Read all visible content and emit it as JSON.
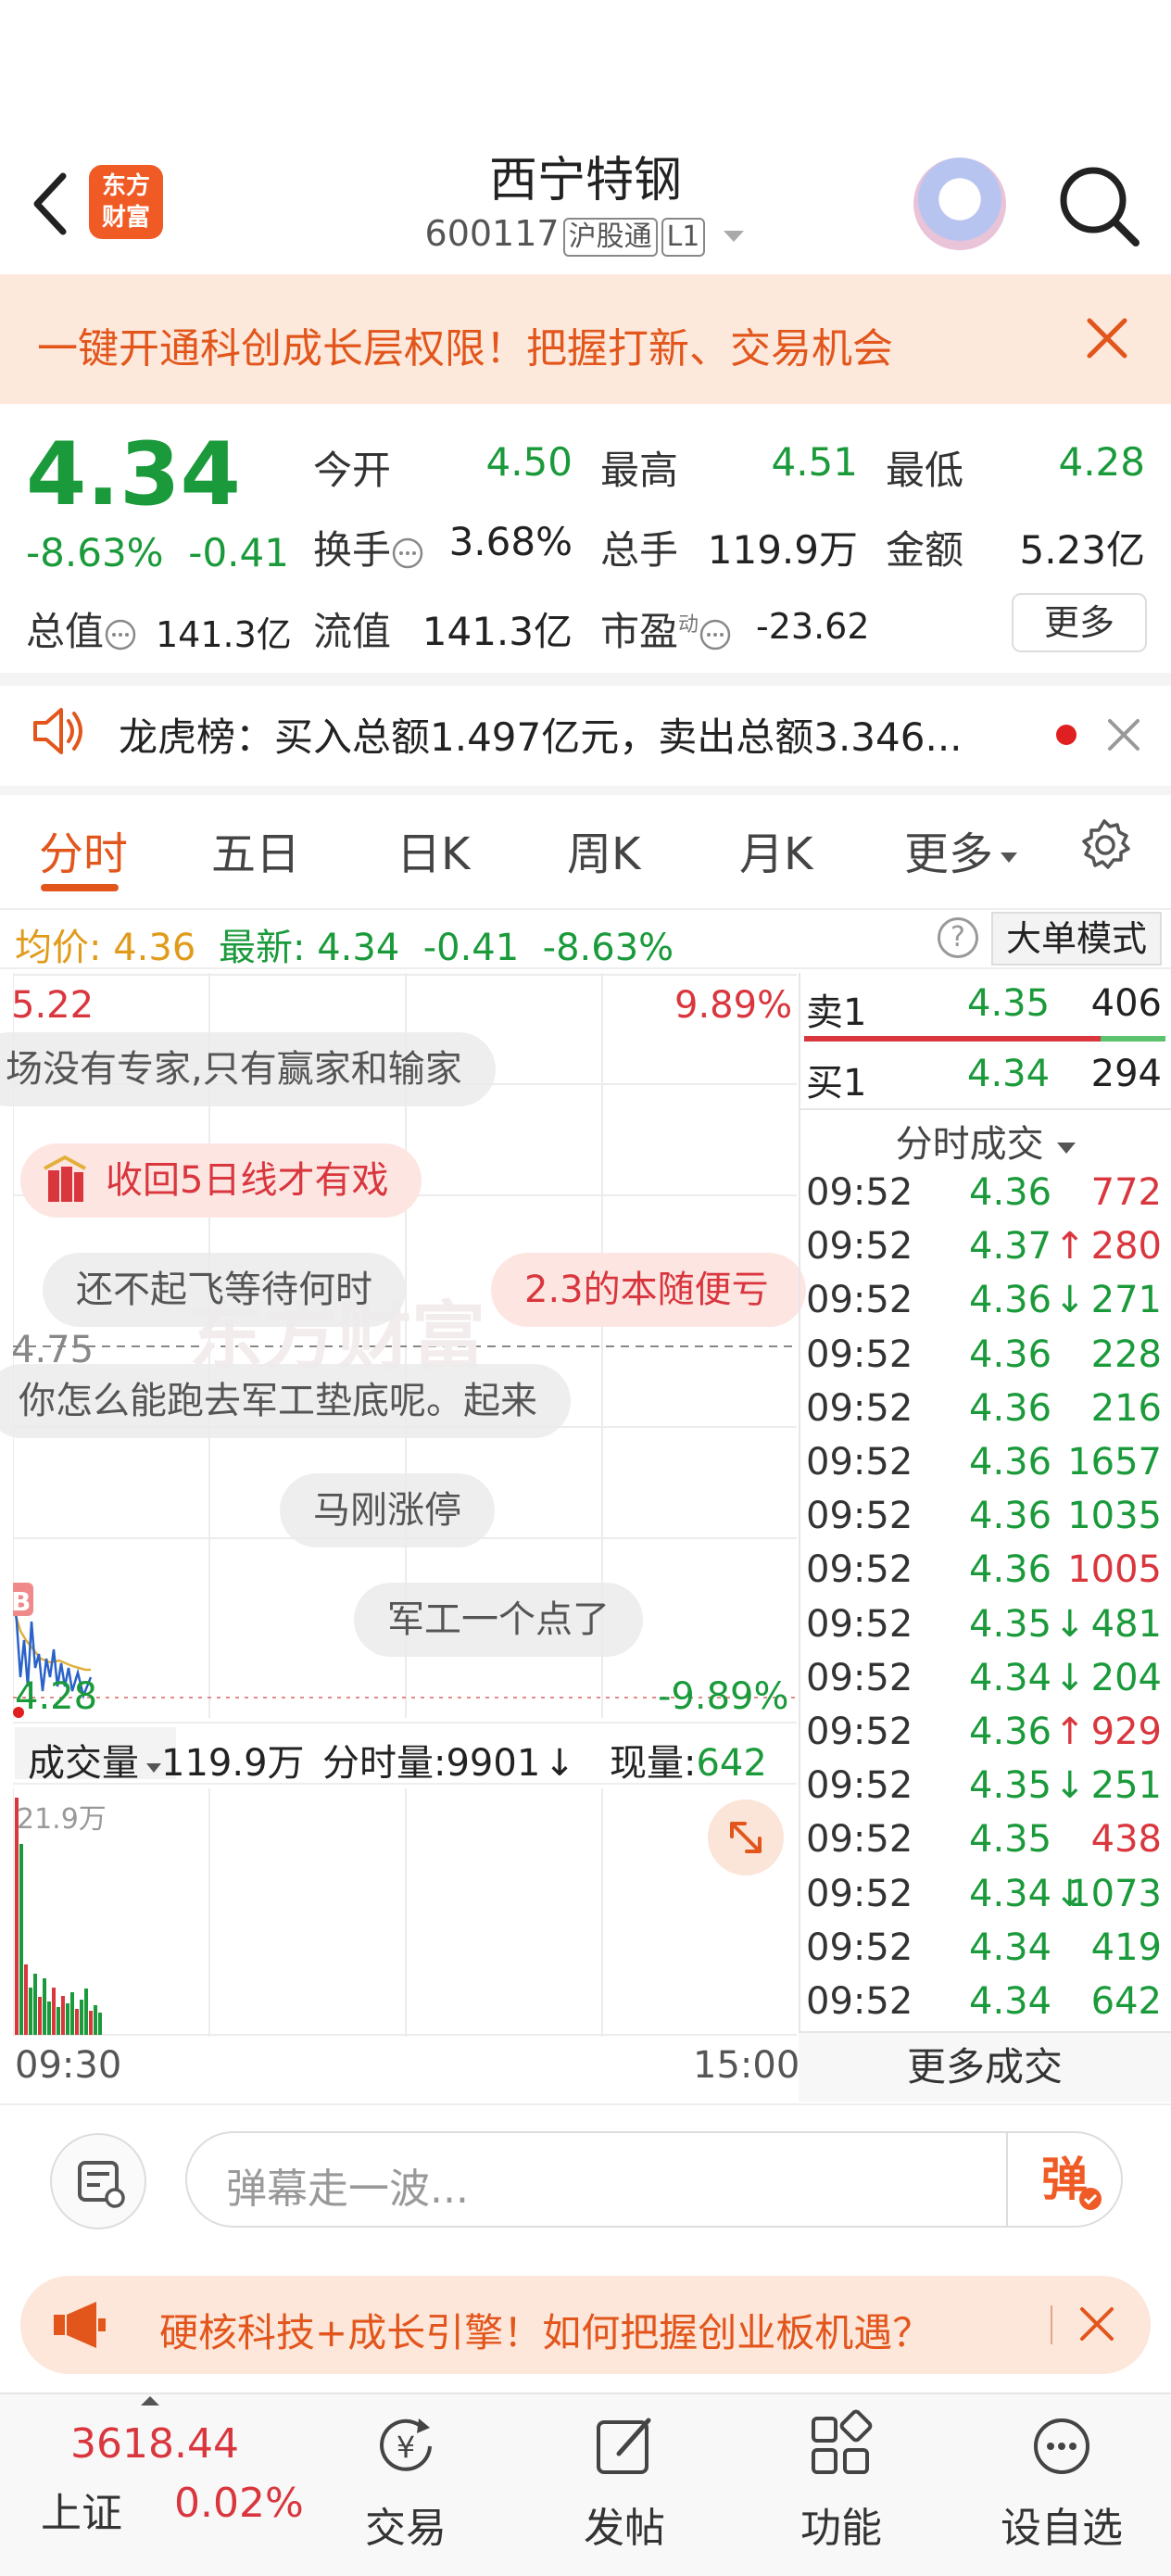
{
  "header": {
    "logo_line1": "东方",
    "logo_line2": "财富",
    "title": "西宁特钢",
    "code": "600117",
    "market_badge": "沪股通",
    "level_badge": "L1"
  },
  "banner": {
    "text": "一键开通科创成长层权限！把握打新、交易机会"
  },
  "quote": {
    "price": "4.34",
    "change_pct": "-8.63%",
    "change_abs": "-0.41",
    "open_label": "今开",
    "open": "4.50",
    "high_label": "最高",
    "high": "4.51",
    "low_label": "最低",
    "low": "4.28",
    "turnover_label": "换手",
    "turnover": "3.68%",
    "volume_label": "总手",
    "volume": "119.9万",
    "amount_label": "金额",
    "amount": "5.23亿",
    "mktcap_label": "总值",
    "mktcap": "141.3亿",
    "float_label": "流值",
    "float_cap": "141.3亿",
    "pe_label": "市盈",
    "pe_sup": "动",
    "pe": "-23.62",
    "more": "更多"
  },
  "notice": {
    "text": "龙虎榜：买入总额1.497亿元，卖出总额3.346..."
  },
  "tabs": [
    "分时",
    "五日",
    "日K",
    "周K",
    "月K",
    "更多"
  ],
  "strip": {
    "avg_label": "均价:",
    "avg": "4.36",
    "latest_label": "最新:",
    "latest": "4.34",
    "chg": "-0.41",
    "pct": "-8.63%",
    "help": "?",
    "bigorder": "大单模式"
  },
  "chart": {
    "y_top": "5.22",
    "pct_top": "9.89%",
    "y_mid": "4.75",
    "y_bottom": "4.28",
    "pct_bottom": "-9.89%",
    "marker": "B",
    "danmu": [
      "场没有专家,只有赢家和输家",
      "收回5日线才有戏",
      "还不起飞等待何时",
      "2.3的本随便亏",
      "你怎么能跑去军工垫底呢。起来",
      "马刚涨停",
      "军工一个点了"
    ],
    "watermark": "东方财富",
    "vol_label": "成交量",
    "vol_total": "119.9万",
    "min_vol_label": "分时量:",
    "min_vol": "9901",
    "cur_vol_label": "现量:",
    "cur_vol": "642",
    "vol_max": "21.9万",
    "time_start": "09:30",
    "time_end": "15:00"
  },
  "orderbook": {
    "ask_label": "卖1",
    "ask_price": "4.35",
    "ask_vol": "406",
    "bid_label": "买1",
    "bid_price": "4.34",
    "bid_vol": "294"
  },
  "trades": {
    "title": "分时成交",
    "rows": [
      {
        "t": "09:52",
        "p": "4.36",
        "a": "",
        "v": "772",
        "pc": "green",
        "vc": "red"
      },
      {
        "t": "09:52",
        "p": "4.37",
        "a": "↑",
        "v": "280",
        "pc": "green",
        "vc": "red"
      },
      {
        "t": "09:52",
        "p": "4.36",
        "a": "↓",
        "v": "271",
        "pc": "green",
        "vc": "green"
      },
      {
        "t": "09:52",
        "p": "4.36",
        "a": "",
        "v": "228",
        "pc": "green",
        "vc": "green"
      },
      {
        "t": "09:52",
        "p": "4.36",
        "a": "",
        "v": "216",
        "pc": "green",
        "vc": "green"
      },
      {
        "t": "09:52",
        "p": "4.36",
        "a": "",
        "v": "1657",
        "pc": "green",
        "vc": "green"
      },
      {
        "t": "09:52",
        "p": "4.36",
        "a": "",
        "v": "1035",
        "pc": "green",
        "vc": "green"
      },
      {
        "t": "09:52",
        "p": "4.36",
        "a": "",
        "v": "1005",
        "pc": "green",
        "vc": "red"
      },
      {
        "t": "09:52",
        "p": "4.35",
        "a": "↓",
        "v": "481",
        "pc": "green",
        "vc": "green"
      },
      {
        "t": "09:52",
        "p": "4.34",
        "a": "↓",
        "v": "204",
        "pc": "green",
        "vc": "green"
      },
      {
        "t": "09:52",
        "p": "4.36",
        "a": "↑",
        "v": "929",
        "pc": "green",
        "vc": "red"
      },
      {
        "t": "09:52",
        "p": "4.35",
        "a": "↓",
        "v": "251",
        "pc": "green",
        "vc": "green"
      },
      {
        "t": "09:52",
        "p": "4.35",
        "a": "",
        "v": "438",
        "pc": "green",
        "vc": "red"
      },
      {
        "t": "09:52",
        "p": "4.34",
        "a": "↓",
        "v": "1073",
        "pc": "green",
        "vc": "green"
      },
      {
        "t": "09:52",
        "p": "4.34",
        "a": "",
        "v": "419",
        "pc": "green",
        "vc": "green"
      },
      {
        "t": "09:52",
        "p": "4.34",
        "a": "",
        "v": "642",
        "pc": "green",
        "vc": "green"
      }
    ],
    "more": "更多成交"
  },
  "comment": {
    "placeholder": "弹幕走一波...",
    "send": "弹"
  },
  "promo": {
    "text": "硬核科技+成长引擎！如何把握创业板机遇？"
  },
  "bottom_nav": {
    "index_value": "3618.44",
    "index_name": "上证",
    "index_pct": "0.02%",
    "items": [
      "交易",
      "发帖",
      "功能",
      "设自选"
    ]
  },
  "colors": {
    "up": "#d9363e",
    "down": "#1a9a3a",
    "brand": "#f05a24"
  }
}
